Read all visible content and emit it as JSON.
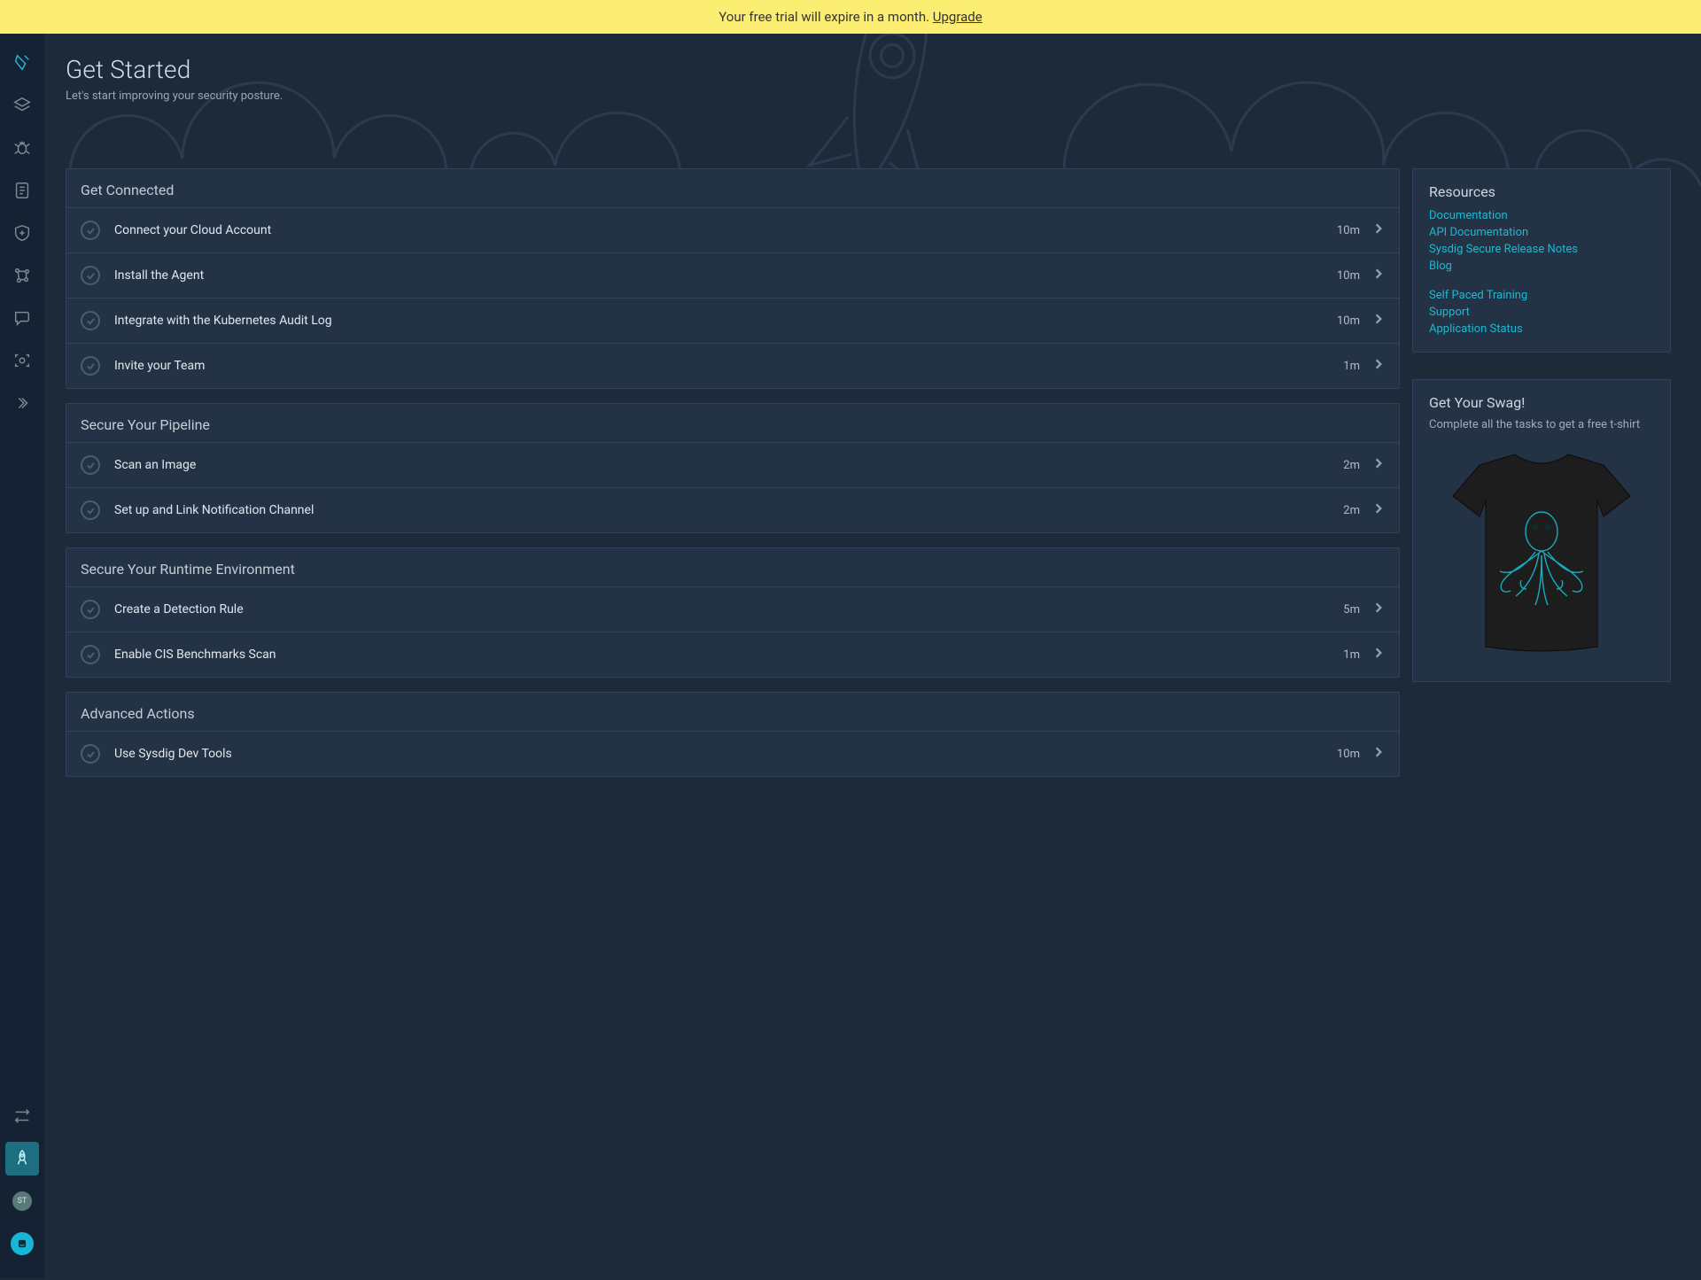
{
  "banner": {
    "text": "Your free trial will expire in a month. ",
    "link": "Upgrade"
  },
  "header": {
    "title": "Get Started",
    "subtitle": "Let's start improving your security posture."
  },
  "sidebar": {
    "avatar_initials": "ST"
  },
  "sections": [
    {
      "title": "Get Connected",
      "tasks": [
        {
          "label": "Connect your Cloud Account",
          "time": "10m"
        },
        {
          "label": "Install the Agent",
          "time": "10m"
        },
        {
          "label": "Integrate with the Kubernetes Audit Log",
          "time": "10m"
        },
        {
          "label": "Invite your Team",
          "time": "1m"
        }
      ]
    },
    {
      "title": "Secure Your Pipeline",
      "tasks": [
        {
          "label": "Scan an Image",
          "time": "2m"
        },
        {
          "label": "Set up and Link Notification Channel",
          "time": "2m"
        }
      ]
    },
    {
      "title": "Secure Your Runtime Environment",
      "tasks": [
        {
          "label": "Create a Detection Rule",
          "time": "5m"
        },
        {
          "label": "Enable CIS Benchmarks Scan",
          "time": "1m"
        }
      ]
    },
    {
      "title": "Advanced Actions",
      "tasks": [
        {
          "label": "Use Sysdig Dev Tools",
          "time": "10m"
        }
      ]
    }
  ],
  "resources": {
    "title": "Resources",
    "primary_links": [
      "Documentation",
      "API Documentation",
      "Sysdig Secure Release Notes",
      "Blog"
    ],
    "secondary_links": [
      "Self Paced Training",
      "Support",
      "Application Status"
    ]
  },
  "swag": {
    "title": "Get Your Swag!",
    "text": "Complete all the tasks to get a free t-shirt"
  }
}
